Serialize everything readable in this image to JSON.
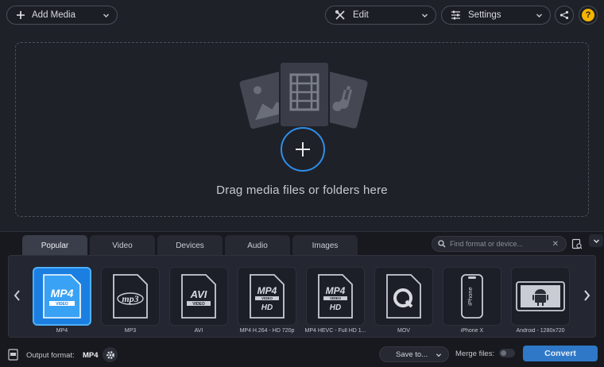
{
  "toolbar": {
    "add_media_label": "Add Media",
    "edit_label": "Edit",
    "settings_label": "Settings",
    "help_label": "?"
  },
  "dropzone": {
    "text": "Drag media files or folders here"
  },
  "tabs": [
    {
      "label": "Popular",
      "active": true
    },
    {
      "label": "Video",
      "active": false
    },
    {
      "label": "Devices",
      "active": false
    },
    {
      "label": "Audio",
      "active": false
    },
    {
      "label": "Images",
      "active": false
    }
  ],
  "search": {
    "placeholder": "Find format or device...",
    "clear_label": "✕"
  },
  "formats": [
    {
      "caption": "MP4",
      "icon": "mp4-icon",
      "tag": "MP4",
      "selected": true
    },
    {
      "caption": "MP3",
      "icon": "mp3-icon",
      "tag": "mp3",
      "selected": false
    },
    {
      "caption": "AVI",
      "icon": "avi-icon",
      "tag": "AVI",
      "selected": false
    },
    {
      "caption": "MP4 H.264 - HD 720p",
      "icon": "mp4-hd-icon",
      "tag": "MP4",
      "selected": false
    },
    {
      "caption": "MP4 HEVC - Full HD 1...",
      "icon": "mp4-hevc-icon",
      "tag": "MP4",
      "selected": false
    },
    {
      "caption": "MOV",
      "icon": "quicktime-icon",
      "tag": "",
      "selected": false
    },
    {
      "caption": "iPhone X",
      "icon": "iphone-icon",
      "tag": "iPhone",
      "selected": false
    },
    {
      "caption": "Android - 1280x720",
      "icon": "android-icon",
      "tag": "",
      "selected": false
    }
  ],
  "format_sub": {
    "video_tag": "VIDEO",
    "hd_tag": "HD"
  },
  "status": {
    "output_format_label": "Output format:",
    "output_format_value": "MP4",
    "save_to_label": "Save to...",
    "merge_files_label": "Merge files:",
    "convert_label": "Convert"
  },
  "colors": {
    "accent": "#1a7fe0",
    "plus_ring": "#2f8ee9",
    "help": "#f5b400",
    "convert": "#2f78c8"
  }
}
